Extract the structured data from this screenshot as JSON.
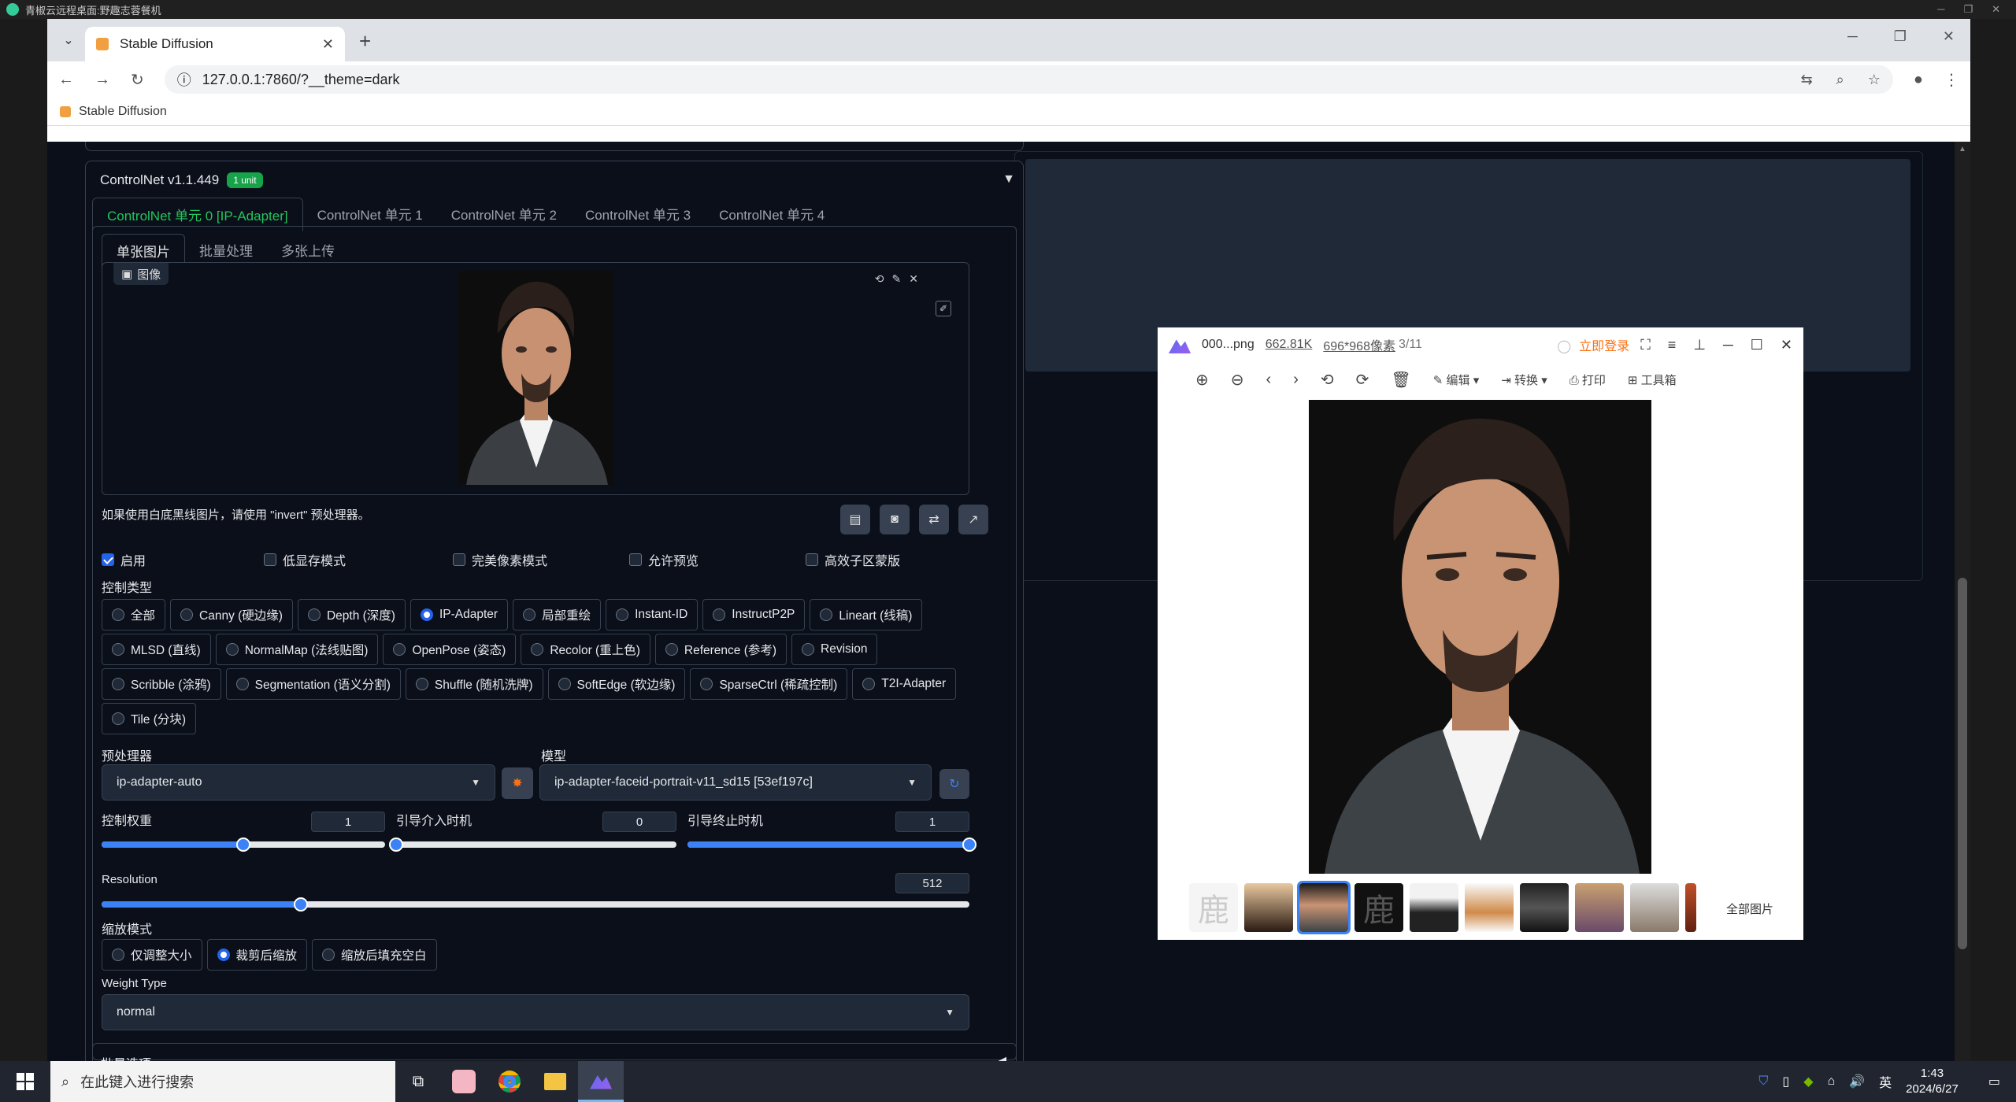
{
  "remote": {
    "title": "青椒云远程桌面:野趣志蓉餐机"
  },
  "browser": {
    "tab_title": "Stable Diffusion",
    "url": "127.0.0.1:7860/?__theme=dark",
    "bookmark": "Stable Diffusion"
  },
  "controlnet": {
    "title": "ControlNet v1.1.449",
    "badge": "1 unit",
    "unit_tabs": [
      "ControlNet 单元 0 [IP-Adapter]",
      "ControlNet 单元 1",
      "ControlNet 单元 2",
      "ControlNet 单元 3",
      "ControlNet 单元 4"
    ],
    "image_tabs": [
      "单张图片",
      "批量处理",
      "多张上传"
    ],
    "image_label": "图像",
    "hint": "如果使用白底黑线图片，请使用 \"invert\" 预处理器。",
    "checkboxes": [
      {
        "label": "启用",
        "checked": true
      },
      {
        "label": "低显存模式",
        "checked": false
      },
      {
        "label": "完美像素模式",
        "checked": false
      },
      {
        "label": "允许预览",
        "checked": false
      },
      {
        "label": "高效子区蒙版",
        "checked": false
      }
    ],
    "control_type_label": "控制类型",
    "control_types_row1": [
      "全部",
      "Canny (硬边缘)",
      "Depth (深度)",
      "IP-Adapter",
      "局部重绘",
      "Instant-ID",
      "InstructP2P",
      "Lineart (线稿)"
    ],
    "control_types_row2": [
      "MLSD (直线)",
      "NormalMap (法线贴图)",
      "OpenPose (姿态)",
      "Recolor (重上色)",
      "Reference (参考)",
      "Revision"
    ],
    "control_types_row3": [
      "Scribble (涂鸦)",
      "Segmentation (语义分割)",
      "Shuffle (随机洗牌)",
      "SoftEdge (软边缘)",
      "SparseCtrl (稀疏控制)",
      "T2I-Adapter"
    ],
    "control_types_row4": [
      "Tile (分块)"
    ],
    "selected_control_type": "IP-Adapter",
    "preprocessor_label": "预处理器",
    "preprocessor": "ip-adapter-auto",
    "model_label": "模型",
    "model": "ip-adapter-faceid-portrait-v11_sd15 [53ef197c]",
    "weight_label": "控制权重",
    "weight": "1",
    "weight_fraction": 0.5,
    "start_label": "引导介入时机",
    "start": "0",
    "start_fraction": 0.0,
    "end_label": "引导终止时机",
    "end": "1",
    "end_fraction": 1.0,
    "resolution_label": "Resolution",
    "resolution": "512",
    "resolution_fraction": 0.23,
    "resize_mode_label": "缩放模式",
    "resize_modes": [
      "仅调整大小",
      "裁剪后缩放",
      "缩放后填充空白"
    ],
    "selected_resize_mode": "裁剪后缩放",
    "weight_type_label": "Weight Type",
    "weight_type": "normal",
    "batch_options": "批量选项"
  },
  "viewer": {
    "filename": "000...png",
    "filesize": "662.81K",
    "dimensions": "696*968像素",
    "index": "3/11",
    "login": "立即登录",
    "tools": {
      "edit": "编辑",
      "convert": "转换",
      "print": "打印",
      "toolbox": "工具箱"
    },
    "all_images": "全部图片",
    "thumb_char": "鹿"
  },
  "taskbar": {
    "search_placeholder": "在此键入进行搜索",
    "ime": "英",
    "time": "1:43",
    "date": "2024/6/27"
  },
  "colors": {
    "accent": "#3b82f6",
    "enabled_green": "#22c55e",
    "badge": "#16a34a",
    "page_bg": "#0b0f19"
  }
}
